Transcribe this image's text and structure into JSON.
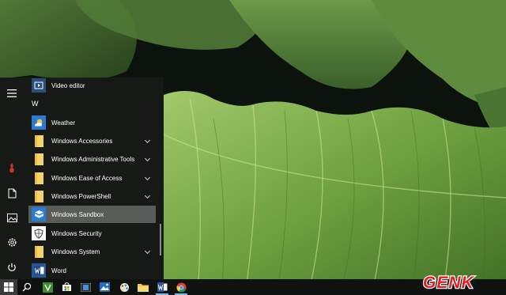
{
  "start_menu": {
    "letter_header": "W",
    "apps": [
      {
        "label": "Video editor",
        "icon": "video-editor-icon",
        "expandable": false
      },
      {
        "label": "Weather",
        "icon": "weather-icon",
        "expandable": false
      },
      {
        "label": "Windows Accessories",
        "icon": "folder-icon",
        "expandable": true
      },
      {
        "label": "Windows Administrative Tools",
        "icon": "folder-icon",
        "expandable": true
      },
      {
        "label": "Windows Ease of Access",
        "icon": "folder-icon",
        "expandable": true
      },
      {
        "label": "Windows PowerShell",
        "icon": "folder-icon",
        "expandable": true
      },
      {
        "label": "Windows Sandbox",
        "icon": "sandbox-icon",
        "expandable": false,
        "selected": true
      },
      {
        "label": "Windows Security",
        "icon": "shield-icon",
        "expandable": false
      },
      {
        "label": "Windows System",
        "icon": "folder-icon",
        "expandable": true
      },
      {
        "label": "Word",
        "icon": "word-icon",
        "expandable": false
      }
    ],
    "rail": [
      "hamburger-menu-icon",
      "user-avatar-icon",
      "documents-icon",
      "pictures-icon",
      "settings-icon",
      "power-icon"
    ]
  },
  "taskbar": {
    "items": [
      "start-icon",
      "search-icon",
      "vim-icon",
      "store-icon",
      "film-icon",
      "photos-icon",
      "paint-icon",
      "file-explorer-icon",
      "word-icon",
      "chrome-icon"
    ],
    "active": [
      "word-icon",
      "chrome-icon"
    ]
  },
  "watermark": {
    "brand": "GENK"
  },
  "colors": {
    "menu_bg": "#181a18",
    "selected_row": "#5a5c5a",
    "folder_yellow": "#f4d36a",
    "accent_blue": "#2b7bd1",
    "brand_red": "#e31e24"
  }
}
